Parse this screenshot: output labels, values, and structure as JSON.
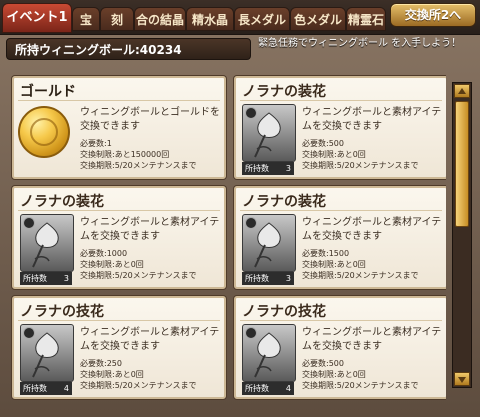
{
  "tabs": [
    {
      "label": "イベント1",
      "active": true
    },
    {
      "label": "宝",
      "active": false
    },
    {
      "label": "刻",
      "active": false
    },
    {
      "label": "合の結晶",
      "active": false
    },
    {
      "label": "精水晶",
      "active": false
    },
    {
      "label": "長メダル",
      "active": false
    },
    {
      "label": "色メダル",
      "active": false
    },
    {
      "label": "精霊石",
      "active": false
    }
  ],
  "exchange_button": "交換所2へ",
  "held_balls": "所持ウィニングボール:40234",
  "notice": "緊急任務でウィニングボール を入手しよう！",
  "owned_label": "所持数",
  "cards": [
    {
      "title": "ゴールド",
      "icon": "gold-coin-icon",
      "desc": "ウィニングボールとゴールドを交換できます",
      "required": "必要数:1",
      "limit": "交換制限:あと150000回",
      "period": "交換期限:5/20メンテナンスまで",
      "owned": ""
    },
    {
      "title": "ノラナの装花",
      "icon": "flower-icon",
      "desc": "ウィニングボールと素材アイテムを交換できます",
      "required": "必要数:500",
      "limit": "交換制限:あと0回",
      "period": "交換期限:5/20メンテナンスまで",
      "owned": "3"
    },
    {
      "title": "ノラナの装花",
      "icon": "flower-icon",
      "desc": "ウィニングボールと素材アイテムを交換できます",
      "required": "必要数:1000",
      "limit": "交換制限:あと0回",
      "period": "交換期限:5/20メンテナンスまで",
      "owned": "3"
    },
    {
      "title": "ノラナの装花",
      "icon": "flower-icon",
      "desc": "ウィニングボールと素材アイテムを交換できます",
      "required": "必要数:1500",
      "limit": "交換制限:あと0回",
      "period": "交換期限:5/20メンテナンスまで",
      "owned": "3"
    },
    {
      "title": "ノラナの技花",
      "icon": "flower-icon",
      "desc": "ウィニングボールと素材アイテムを交換できます",
      "required": "必要数:250",
      "limit": "交換制限:あと0回",
      "period": "交換期限:5/20メンテナンスまで",
      "owned": "4"
    },
    {
      "title": "ノラナの技花",
      "icon": "flower-icon",
      "desc": "ウィニングボールと素材アイテムを交換できます",
      "required": "必要数:500",
      "limit": "交換制限:あと0回",
      "period": "交換期限:5/20メンテナンスまで",
      "owned": "4"
    }
  ],
  "scroll": {
    "position": 0.0
  }
}
